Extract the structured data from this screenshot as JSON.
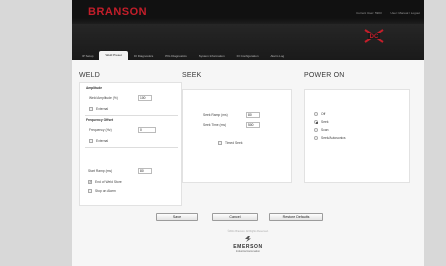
{
  "header": {
    "logo": "BRANSON",
    "current_user": "Current User: 5903",
    "user_link": "User: Manual / Logout",
    "brand_mark": "DC"
  },
  "tabs": [
    {
      "label": "IP Setup",
      "active": false
    },
    {
      "label": "Weld Preset",
      "active": true
    },
    {
      "label": "IO Diagnostics",
      "active": false
    },
    {
      "label": "PIG Diagnostics",
      "active": false
    },
    {
      "label": "System Information",
      "active": false
    },
    {
      "label": "IO Configuration",
      "active": false
    },
    {
      "label": "Alarm Log",
      "active": false
    }
  ],
  "weld": {
    "title": "WELD",
    "amplitude": {
      "group": "Amplitude",
      "label": "Weld Amplitude (%)",
      "value": "100",
      "external_label": "External",
      "external_checked": false
    },
    "frequency": {
      "group": "Frequency Offset",
      "label": "Frequency (Hz)",
      "value": "0",
      "external_label": "External",
      "external_checked": false
    },
    "start_ramp": {
      "label": "Start Ramp (ms)",
      "value": "80"
    },
    "end_of_weld_store": {
      "label": "End of Weld Store",
      "checked": true
    },
    "stop_on_alarm": {
      "label": "Stop on Alarm",
      "checked": false
    }
  },
  "seek": {
    "title": "SEEK",
    "ramp": {
      "label": "Seek Ramp (ms)",
      "value": "80"
    },
    "time": {
      "label": "Seek Time (ms)",
      "value": "500"
    },
    "timed": {
      "label": "Timed Seek",
      "checked": false
    }
  },
  "power_on": {
    "title": "POWER ON",
    "options": [
      {
        "label": "Off",
        "selected": false
      },
      {
        "label": "Seek",
        "selected": true
      },
      {
        "label": "Scan",
        "selected": false
      },
      {
        "label": "Seek/Autosonics",
        "selected": false
      }
    ]
  },
  "buttons": {
    "save": "Save",
    "cancel": "Cancel",
    "restore": "Restore Defaults"
  },
  "footer": {
    "copyright": "©2011 Branson. All Rights Reserved.",
    "emerson": "EMERSON",
    "emerson_sub": "Industrial Automation"
  },
  "colors": {
    "brand_red": "#c41e2a",
    "header_bg": "#111111",
    "page_bg": "#d8d8d8"
  }
}
